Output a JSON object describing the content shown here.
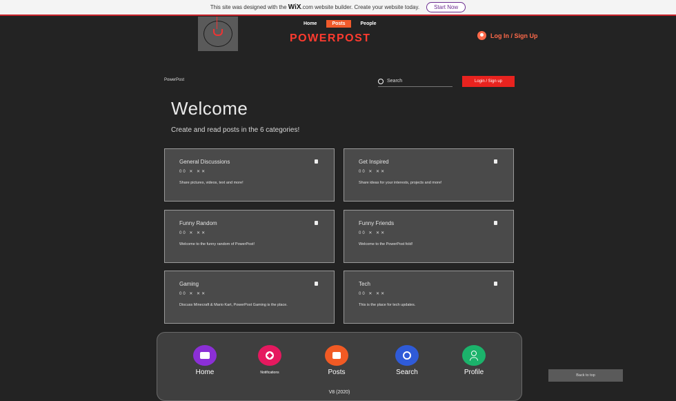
{
  "wix_banner": {
    "text_before": "This site was designed with the",
    "brand": "WiX",
    "text_after": ".com website builder. Create your website today.",
    "cta": "Start Now"
  },
  "nav": {
    "items": [
      "Home",
      "Posts",
      "People"
    ],
    "active": "Posts"
  },
  "brand": {
    "name": "POWERPOST",
    "color": "#ff3b2f"
  },
  "header": {
    "login": "Log In / Sign Up"
  },
  "toolbar": {
    "breadcrumb": "PowerPost",
    "search_placeholder": "Search",
    "login_button": "Login / Sign up"
  },
  "main": {
    "title": "Welcome",
    "subtitle": "Create and read posts in the 6 categories!"
  },
  "categories": [
    {
      "title": "General Discussions",
      "stats": "00 ✕ ✕✕",
      "desc": "Share pictures, videos, text and more!"
    },
    {
      "title": "Get Inspired",
      "stats": "00 ✕ ✕✕",
      "desc": "Share ideas for your interests, projects and more!"
    },
    {
      "title": "Funny Random",
      "stats": "00 ✕ ✕✕",
      "desc": "Welcome to the funny random of PowerPost!"
    },
    {
      "title": "Funny Friends",
      "stats": "00 ✕ ✕✕",
      "desc": "Welcome to the PowerPost fold!"
    },
    {
      "title": "Gaming",
      "stats": "00 ✕ ✕✕",
      "desc": "Discuss Minecraft & Mario Kart, PowerPost Gaming is the place."
    },
    {
      "title": "Tech",
      "stats": "00 ✕ ✕✕",
      "desc": "This is the place for tech updates."
    }
  ],
  "bottom_nav": [
    {
      "label": "Home",
      "icon": "home-icon",
      "color": "#8b2fd6"
    },
    {
      "label": "Notifications",
      "icon": "bell-icon",
      "color": "#e5195f"
    },
    {
      "label": "Posts",
      "icon": "posts-icon",
      "color": "#f15a24"
    },
    {
      "label": "Search",
      "icon": "search-icon",
      "color": "#2f5bd8"
    },
    {
      "label": "Profile",
      "icon": "profile-icon",
      "color": "#1bb36b"
    }
  ],
  "version": "V8 (2020)",
  "side_button": "Back to top"
}
